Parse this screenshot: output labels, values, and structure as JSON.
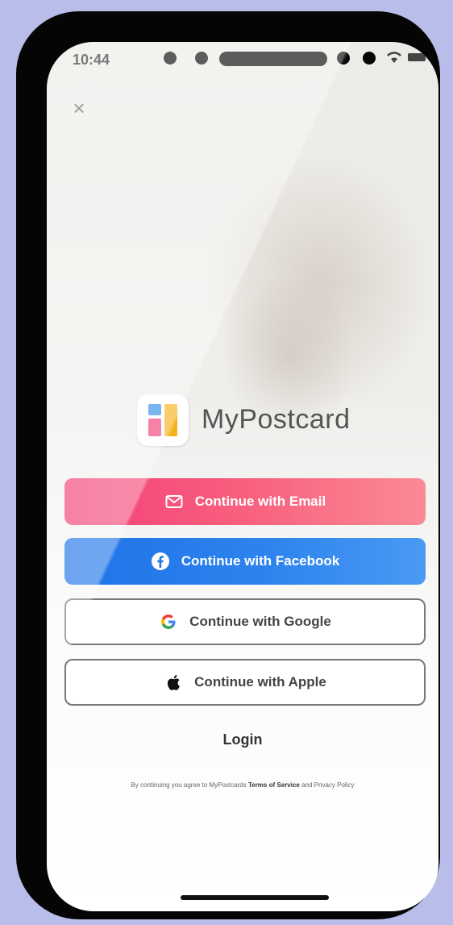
{
  "status_bar": {
    "time": "10:44"
  },
  "brand": {
    "name": "MyPostcard"
  },
  "buttons": {
    "email": {
      "label": "Continue with Email",
      "icon": "mail-icon",
      "color": "#f23f77"
    },
    "facebook": {
      "label": "Continue with Facebook",
      "icon": "facebook-icon",
      "color": "#1f73e8"
    },
    "google": {
      "label": "Continue with Google",
      "icon": "google-icon"
    },
    "apple": {
      "label": "Continue with Apple",
      "icon": "apple-icon"
    }
  },
  "login": {
    "label": "Login"
  },
  "legal": {
    "prefix": "By continuing you agree to MyPostcards",
    "terms": "Terms of Service",
    "middle": "and",
    "privacy": "Privacy Policy"
  },
  "icons": {
    "close": "close-icon",
    "wifi": "wifi-icon",
    "battery": "battery-icon"
  }
}
